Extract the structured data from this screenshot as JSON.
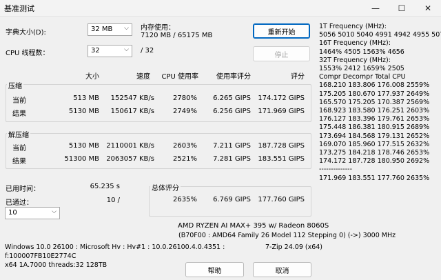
{
  "window": {
    "title": "基准测试",
    "minimize": "—",
    "maximize": "☐",
    "close": "✕"
  },
  "settings": {
    "dict_label": "字典大小(D):",
    "dict_value": "32 MB",
    "memory_label": "内存使用：",
    "memory_value": "7120 MB / 65175 MB",
    "threads_label": "CPU 线程数：",
    "threads_value": "32",
    "threads_total": "/ 32"
  },
  "buttons": {
    "restart": "重新开始",
    "stop": "停止",
    "help": "帮助",
    "cancel": "取消"
  },
  "table": {
    "headers": {
      "size": "大小",
      "speed": "速度",
      "cpu": "CPU 使用率",
      "rating_cpu": "使用率评分",
      "rating": "评分"
    },
    "compress": {
      "label": "压缩",
      "rows": [
        {
          "name": "当前",
          "size": "513 MB",
          "speed": "152547 KB/s",
          "cpu": "2780%",
          "rating_cpu": "6.265 GIPS",
          "rating": "174.172 GIPS"
        },
        {
          "name": "结果",
          "size": "5130 MB",
          "speed": "150617 KB/s",
          "cpu": "2749%",
          "rating_cpu": "6.256 GIPS",
          "rating": "171.969 GIPS"
        }
      ]
    },
    "decompress": {
      "label": "解压缩",
      "rows": [
        {
          "name": "当前",
          "size": "5130 MB",
          "speed": "2110001 KB/s",
          "cpu": "2603%",
          "rating_cpu": "7.211 GIPS",
          "rating": "187.728 GIPS"
        },
        {
          "name": "结果",
          "size": "51300 MB",
          "speed": "2063057 KB/s",
          "cpu": "2521%",
          "rating_cpu": "7.281 GIPS",
          "rating": "183.551 GIPS"
        }
      ]
    }
  },
  "status": {
    "elapsed_label": "已用时间：",
    "elapsed_value": "65.235 s",
    "passes_label": "已通过：",
    "passes_value": "10 /",
    "passes_select": "10"
  },
  "total": {
    "label": "总体评分",
    "cpu": "2635%",
    "rating_cpu": "6.769 GIPS",
    "rating": "177.760 GIPS"
  },
  "system": {
    "cpu_name": "AMD RYZEN AI MAX+ 395 w/ Radeon 8060S",
    "cpu_detail": "(B70F00 : AMD64 Family 26 Model 112 Stepping 0) (->) 3000 MHz",
    "os_line": "Windows 10.0 26100 : Microsoft Hv : Hv#1 : 10.0.26100.4.0.4351 :",
    "flags": "f:100007FB10E2774C",
    "threads": "x64 1A.7000 threads:32 128TB",
    "version": "7-Zip 24.09 (x64)"
  },
  "log": [
    "1T Frequency (MHz):",
    " 5056 5010 5040 4991 4942 4955 5078",
    "16T Frequency (MHz):",
    " 1464% 4505 1563% 4656",
    "32T Frequency (MHz):",
    " 1553% 2412 1659% 2505",
    "Compr Decompr Total   CPU",
    "168.210 183.806 176.008 2559%",
    "175.205 180.670 177.937 2649%",
    "165.570 175.205 170.387 2569%",
    "168.923 183.580 176.251 2603%",
    "176.127 183.396 179.761 2653%",
    "175.448 186.381 180.915 2689%",
    "173.694 184.568 179.131 2652%",
    "169.070 185.960 177.515 2632%",
    "173.275 184.218 178.746 2653%",
    "174.172 187.728 180.950 2692%",
    "--------------",
    "171.969 183.551 177.760 2635%"
  ]
}
